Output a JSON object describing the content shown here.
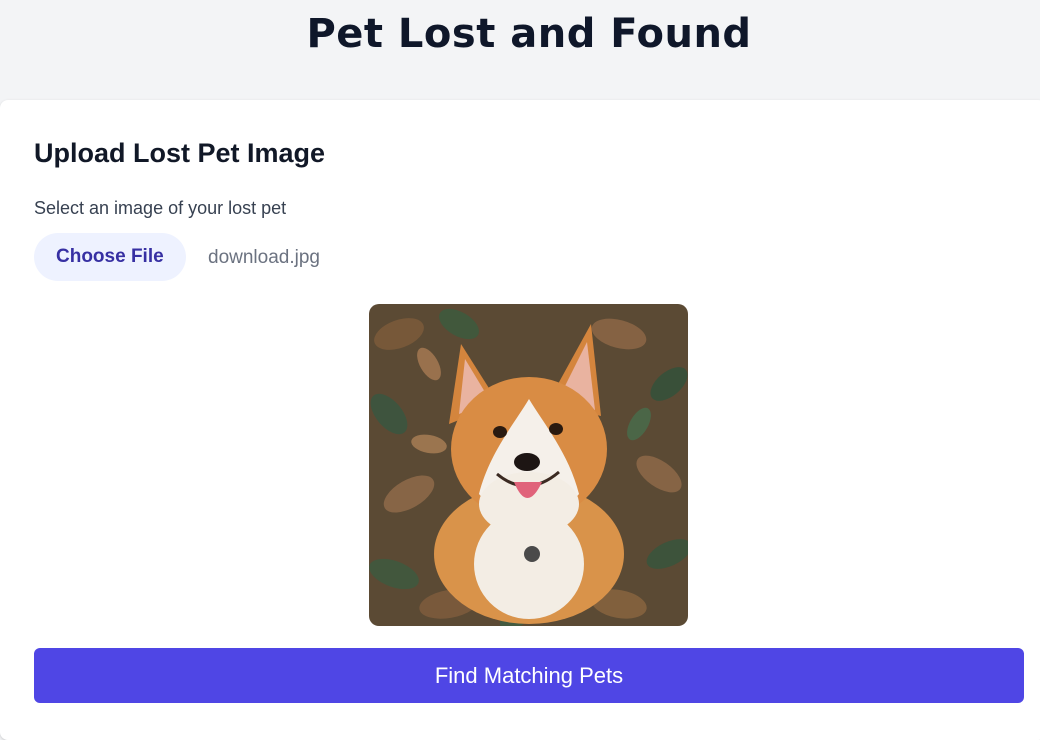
{
  "header": {
    "title": "Pet Lost and Found"
  },
  "upload": {
    "heading": "Upload Lost Pet Image",
    "label": "Select an image of your lost pet",
    "choose_file_label": "Choose File",
    "file_name": "download.jpg",
    "preview_alt": "Uploaded pet image preview"
  },
  "actions": {
    "find_label": "Find Matching Pets"
  },
  "colors": {
    "page_bg": "#f3f4f6",
    "card_bg": "#ffffff",
    "accent": "#4f46e5",
    "file_button_bg": "#eef2ff",
    "file_button_text": "#3730a3"
  }
}
